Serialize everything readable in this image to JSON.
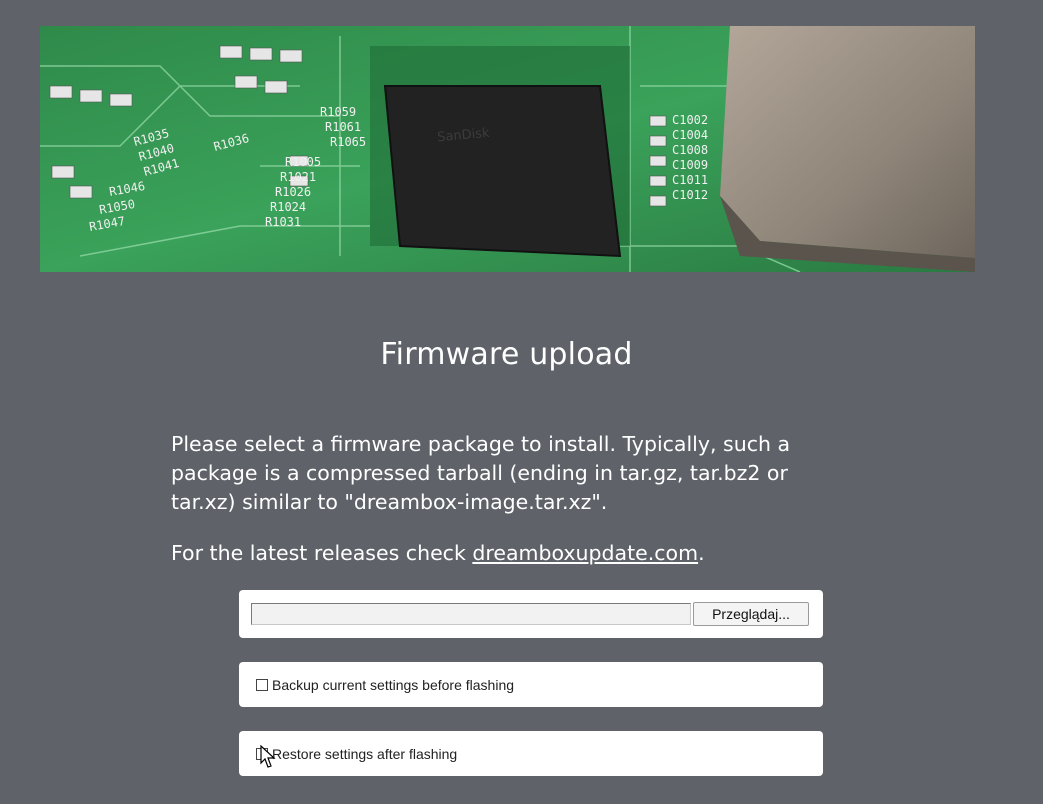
{
  "banner": {
    "chip_brand": "SanDisk",
    "labels": [
      "R1035",
      "R1040",
      "R1041",
      "R1036",
      "R1046",
      "R1050",
      "R1047",
      "R1005",
      "R1021",
      "R1026",
      "R1024",
      "R1031",
      "R1059",
      "R1061",
      "R1065",
      "C1002",
      "C1004",
      "C1008",
      "C1009",
      "C1011",
      "C1012"
    ]
  },
  "page": {
    "title": "Firmware upload"
  },
  "description": "Please select a firmware package to install. Typically, such a package is a compressed tarball (ending in tar.gz, tar.bz2 or tar.xz) similar to \"dreambox-image.tar.xz\".",
  "latest": {
    "prefix": "For the latest releases check ",
    "link_text": "dreamboxupdate.com",
    "suffix": "."
  },
  "file_input": {
    "value": "",
    "browse_label": "Przeglądaj..."
  },
  "options": {
    "backup": {
      "label": "Backup current settings before flashing",
      "checked": false
    },
    "restore": {
      "label": "Restore settings after flashing",
      "checked": false
    }
  }
}
